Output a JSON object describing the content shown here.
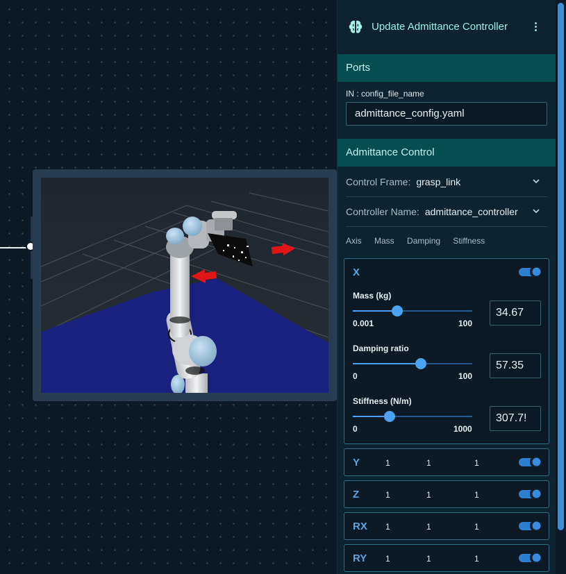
{
  "panel": {
    "title": "Update Admittance Controller",
    "icon": "brain-icon",
    "menu_icon": "more-vertical-icon"
  },
  "ports": {
    "heading": "Ports",
    "input_label": "IN : config_file_name",
    "input_value": "admittance_config.yaml"
  },
  "admittance": {
    "heading": "Admittance Control",
    "control_frame_label": "Control Frame:",
    "control_frame_value": "grasp_link",
    "controller_name_label": "Controller Name:",
    "controller_name_value": "admittance_controller",
    "columns": [
      "Axis",
      "Mass",
      "Damping",
      "Stiffness"
    ]
  },
  "axis_x": {
    "name": "X",
    "enabled": true,
    "mass": {
      "label": "Mass (kg)",
      "min": "0.001",
      "max": "100",
      "value": "34.67",
      "level": 0.37
    },
    "damping": {
      "label": "Damping ratio",
      "min": "0",
      "max": "100",
      "value": "57.35",
      "level": 0.57
    },
    "stiffness": {
      "label": "Stiffness (N/m)",
      "min": "0",
      "max": "1000",
      "value": "307.7!",
      "level": 0.31
    }
  },
  "axes": [
    {
      "name": "Y",
      "mass": "1",
      "damping": "1",
      "stiffness": "1",
      "enabled": true
    },
    {
      "name": "Z",
      "mass": "1",
      "damping": "1",
      "stiffness": "1",
      "enabled": true
    },
    {
      "name": "RX",
      "mass": "1",
      "damping": "1",
      "stiffness": "1",
      "enabled": true
    },
    {
      "name": "RY",
      "mass": "1",
      "damping": "1",
      "stiffness": "1",
      "enabled": true
    }
  ],
  "colors": {
    "accent": "#3a8ce2",
    "section": "#064d50",
    "title": "#9af0e6",
    "axis_label": "#5ba5e6"
  }
}
